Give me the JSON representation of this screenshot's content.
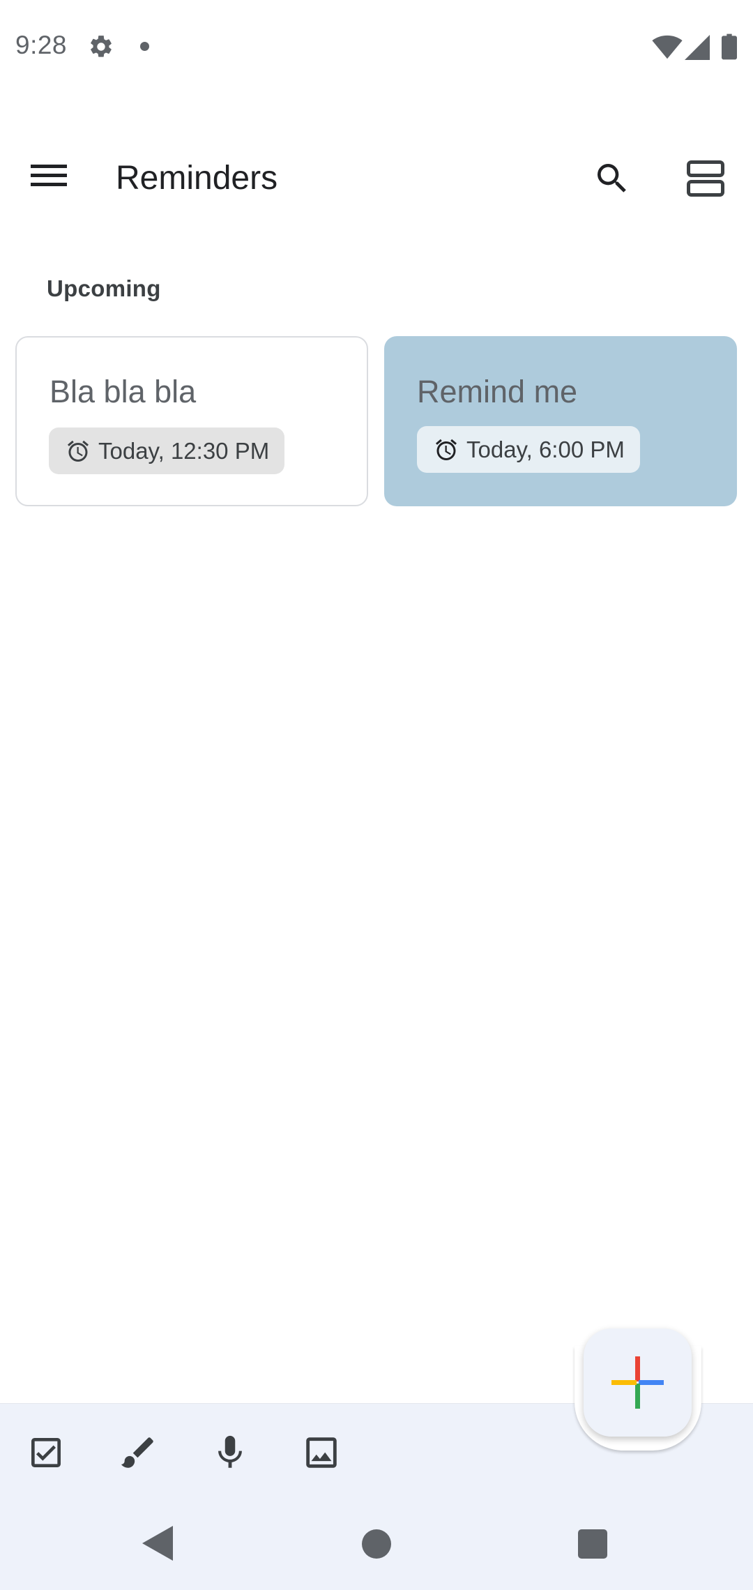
{
  "status_bar": {
    "time": "9:28",
    "icons": [
      "gear-icon",
      "notification-dot",
      "wifi-icon",
      "cell-signal-icon",
      "battery-icon"
    ]
  },
  "app_bar": {
    "title": "Reminders",
    "icons": [
      "menu-icon",
      "search-icon",
      "view-toggle-icon"
    ]
  },
  "section": {
    "header": "Upcoming"
  },
  "cards": [
    {
      "title": "Bla bla bla",
      "reminder": "Today, 12:30 PM",
      "background": "#ffffff",
      "icon": "alarm-icon"
    },
    {
      "title": "Remind me",
      "reminder": "Today, 6:00 PM",
      "background": "#aecbdc",
      "icon": "alarm-icon"
    }
  ],
  "bottom_bar": {
    "tools": [
      "checkbox-icon",
      "brush-icon",
      "mic-icon",
      "image-icon"
    ],
    "fab_icon": "plus-icon",
    "fab_colors": {
      "top": "#ea4335",
      "right": "#4285f4",
      "bottom": "#34a853",
      "left": "#fbbc05"
    },
    "background": "#eef2fa"
  },
  "nav_bar": {
    "buttons": [
      "back-icon",
      "home-icon",
      "recents-icon"
    ]
  }
}
